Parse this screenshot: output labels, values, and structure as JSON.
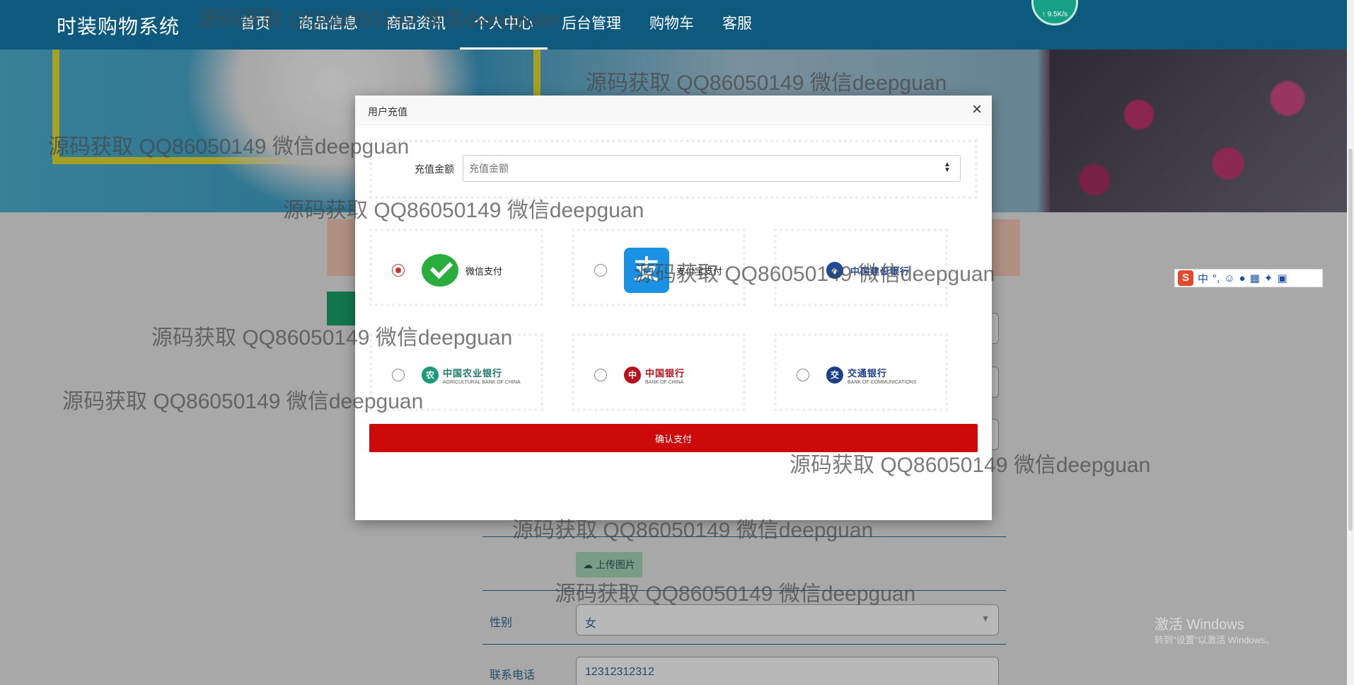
{
  "app": {
    "brand": "时装购物系统"
  },
  "nav": {
    "items": [
      "首页",
      "商品信息",
      "商品资讯",
      "个人中心",
      "后台管理",
      "购物车",
      "客服"
    ],
    "active": "个人中心"
  },
  "speed_widget": {
    "value": "↑ 9.5K/s"
  },
  "modal": {
    "title": "用户充值",
    "close_icon": "close-icon",
    "amount": {
      "label": "充值金额",
      "placeholder": "充值金额",
      "value": ""
    },
    "payment_methods": [
      {
        "name": "微信支付",
        "icon": "wechat-pay-icon",
        "selected": true
      },
      {
        "name": "支付宝支付",
        "icon": "alipay-icon",
        "selected": false
      },
      {
        "name": "中国建设银行",
        "icon": "ccb-icon",
        "selected": false
      },
      {
        "name": "中国农业银行",
        "sub": "AGRICULTURAL BANK OF CHINA",
        "icon": "abc-icon",
        "selected": false
      },
      {
        "name": "中国银行",
        "sub": "BANK OF CHINA",
        "icon": "boc-icon",
        "selected": false
      },
      {
        "name": "交通银行",
        "sub": "BANK OF COMMUNICATIONS",
        "icon": "bocom-icon",
        "selected": false
      }
    ],
    "confirm_label": "确认支付"
  },
  "background_form": {
    "upload_label": "上传图片",
    "gender_label": "性别",
    "gender_value": "女",
    "phone_label": "联系电话",
    "phone_value": "12312312312"
  },
  "ime": {
    "label": "中"
  },
  "windows_activation": {
    "title": "激活 Windows",
    "subtitle": "转到\"设置\"以激活 Windows。"
  },
  "watermark_text": "源码获取 QQ86050149 微信deepguan",
  "colors": {
    "nav_bg": "#0d5a7e",
    "confirm_bg": "#cc0a0a",
    "radio_selected": "#c0392b",
    "wechat_green": "#2aae3b",
    "alipay_blue": "#1a91e3"
  }
}
